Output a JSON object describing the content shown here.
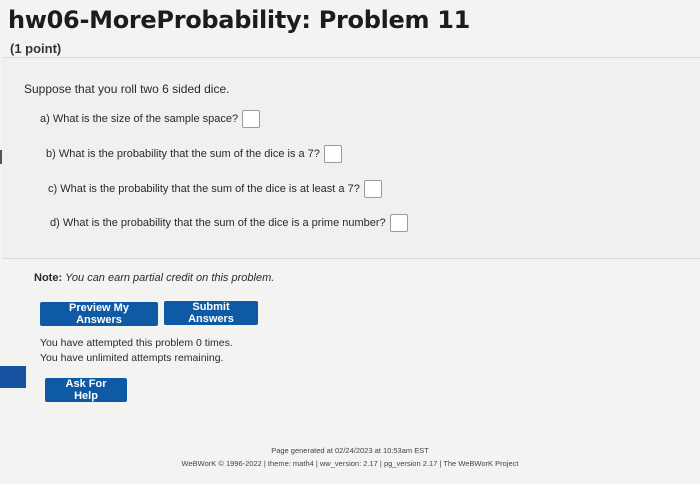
{
  "header": {
    "title": "hw06-MoreProbability: Problem 11",
    "points": "(1 point)"
  },
  "problem": {
    "intro": "Suppose that you roll two 6 sided dice.",
    "questions": [
      "a) What is the size of the sample space?",
      "b) What is the probability that the sum of the dice is a 7?",
      "c) What is the probability that the sum of the dice is at least a 7?",
      "d) What is the probability that the sum of the dice is a prime number?"
    ]
  },
  "note": {
    "label": "Note:",
    "text": "You can earn partial credit on this problem."
  },
  "buttons": {
    "preview": "Preview My Answers",
    "submit": "Submit Answers",
    "help": "Ask For Help"
  },
  "attempts": {
    "line1": "You have attempted this problem 0 times.",
    "line2": "You have unlimited attempts remaining."
  },
  "footer": {
    "generated": "Page generated at 02/24/2023 at 10:53am EST",
    "credits": "WeBWorK © 1996-2022 | theme: math4 | ww_version: 2.17 | pg_version 2.17 | The WeBWorK Project"
  },
  "colors": {
    "button": "#0f5aa5",
    "problem_bg": "#eef0f1"
  }
}
